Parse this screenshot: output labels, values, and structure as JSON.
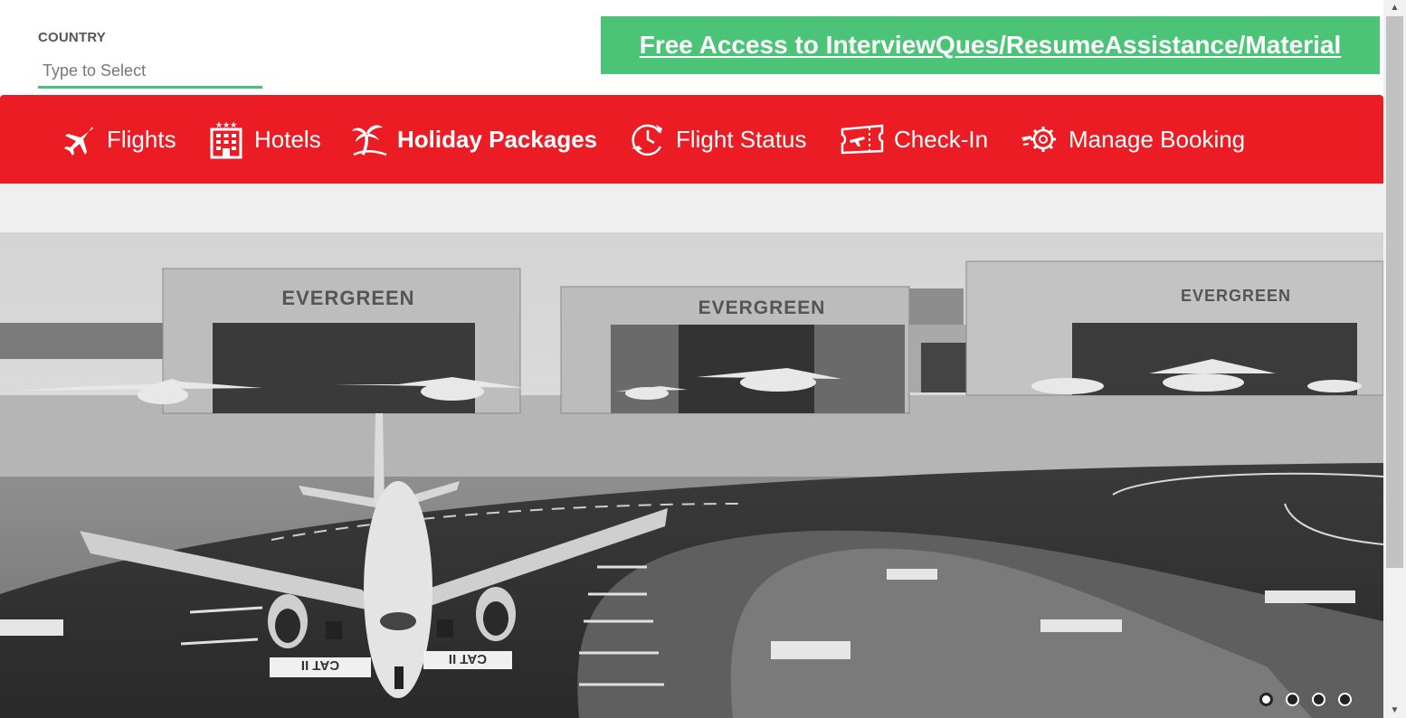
{
  "country": {
    "label": "COUNTRY",
    "placeholder": "Type to Select",
    "value": ""
  },
  "promo": {
    "link_text": "Free Access to InterviewQues/ResumeAssistance/Material"
  },
  "nav": {
    "items": [
      {
        "label": "Flights",
        "icon": "airplane-icon"
      },
      {
        "label": "Hotels",
        "icon": "hotel-building-icon"
      },
      {
        "label": "Holiday Packages",
        "icon": "palm-tree-icon",
        "active": true
      },
      {
        "label": "Flight Status",
        "icon": "clock-plane-icon"
      },
      {
        "label": "Check-In",
        "icon": "ticket-icon"
      },
      {
        "label": "Manage Booking",
        "icon": "gear-plane-icon"
      }
    ]
  },
  "hero": {
    "hangar_signs": [
      "EVERGREEN",
      "EVERGREEN",
      "EVERGREEN"
    ],
    "runway_markings": [
      "CAT II",
      "CAT II"
    ]
  },
  "carousel": {
    "slide_count": 4,
    "active_index": 0
  },
  "colors": {
    "nav_red": "#ec1c24",
    "promo_green": "#4bc477",
    "input_underline": "#4bbf73"
  }
}
